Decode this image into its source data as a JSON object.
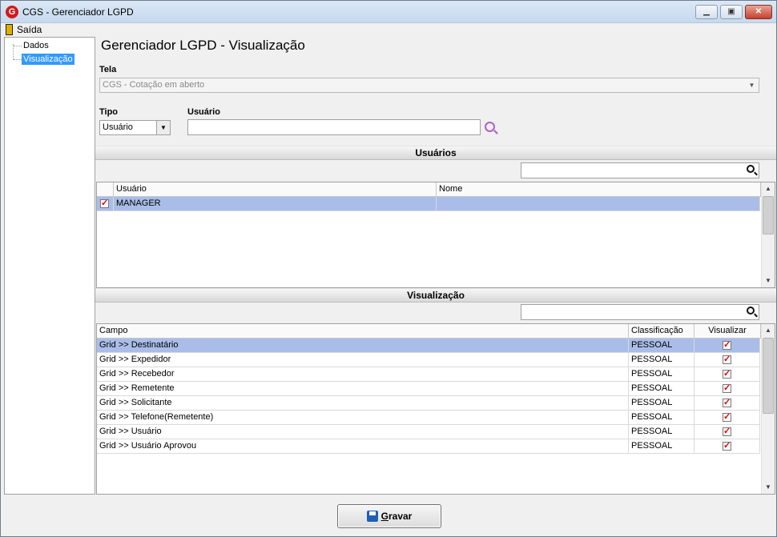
{
  "window": {
    "title": "CGS - Gerenciador LGPD",
    "app_icon_letter": "G",
    "minimize_glyph": "▁",
    "maximize_glyph": "▣",
    "close_glyph": "✕"
  },
  "menu": {
    "exit_label": "Saída"
  },
  "tree": {
    "items": [
      {
        "label": "Dados"
      },
      {
        "label": "Visualização",
        "selected": true
      }
    ]
  },
  "page": {
    "title": "Gerenciador LGPD - Visualização"
  },
  "form": {
    "tela_label": "Tela",
    "tela_value": "CGS - Cotação em aberto",
    "tipo_label": "Tipo",
    "tipo_value": "Usuário",
    "usuario_label": "Usuário",
    "usuario_value": ""
  },
  "usuarios_section": {
    "title": "Usuários",
    "search_value": "",
    "columns": [
      "Usuário",
      "Nome"
    ],
    "rows": [
      {
        "checked": true,
        "usuario": "MANAGER",
        "nome": ""
      }
    ]
  },
  "visualizacao_section": {
    "title": "Visualização",
    "search_value": "",
    "columns": [
      "Campo",
      "Classificação",
      "Visualizar"
    ],
    "rows": [
      {
        "campo": "Grid >> Destinatário",
        "classificacao": "PESSOAL",
        "visualizar": true
      },
      {
        "campo": "Grid >> Expedidor",
        "classificacao": "PESSOAL",
        "visualizar": true
      },
      {
        "campo": "Grid >> Recebedor",
        "classificacao": "PESSOAL",
        "visualizar": true
      },
      {
        "campo": "Grid >> Remetente",
        "classificacao": "PESSOAL",
        "visualizar": true
      },
      {
        "campo": "Grid >> Solicitante",
        "classificacao": "PESSOAL",
        "visualizar": true
      },
      {
        "campo": "Grid >> Telefone(Remetente)",
        "classificacao": "PESSOAL",
        "visualizar": true
      },
      {
        "campo": "Grid >> Usuário",
        "classificacao": "PESSOAL",
        "visualizar": true
      },
      {
        "campo": "Grid >> Usuário Aprovou",
        "classificacao": "PESSOAL",
        "visualizar": true
      }
    ]
  },
  "footer": {
    "save_label_first": "G",
    "save_label_rest": "ravar"
  },
  "colors": {
    "selection": "#a9bde8",
    "tree_selection": "#3399ff",
    "check": "#dd0000"
  }
}
